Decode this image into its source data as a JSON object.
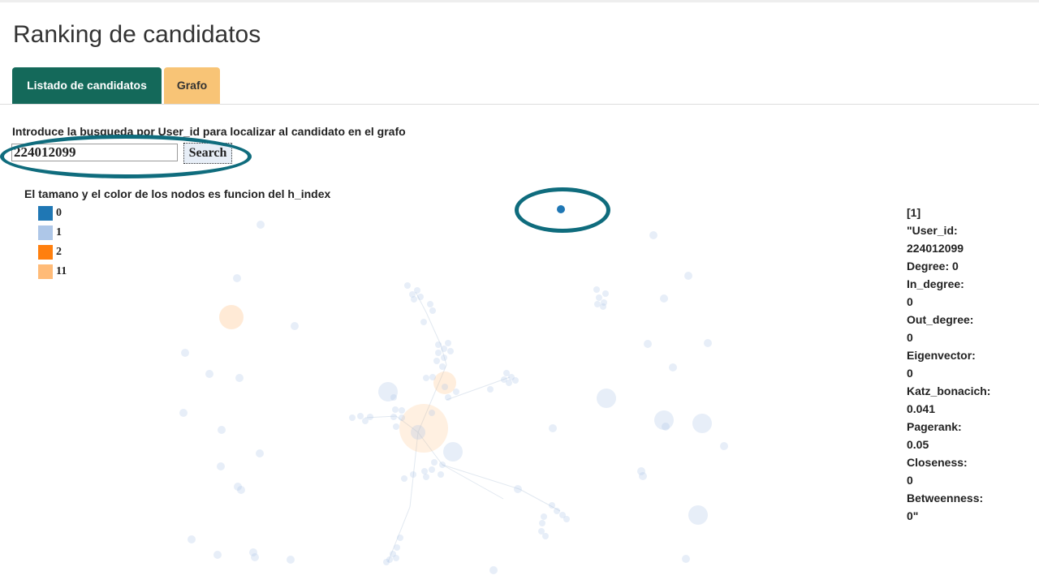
{
  "page": {
    "title": "Ranking de candidatos"
  },
  "tabs": [
    {
      "label": "Listado de candidatos"
    },
    {
      "label": "Grafo"
    }
  ],
  "search": {
    "label": "Introduce la busqueda por User_id para localizar al candidato en el grafo",
    "value": "224012099",
    "button_label": "Search"
  },
  "legend": {
    "title": "El tamano y el color de los nodos es funcion del h_index",
    "items": [
      {
        "label": "0",
        "color": "#1f77b4"
      },
      {
        "label": "1",
        "color": "#aec7e8"
      },
      {
        "label": "2",
        "color": "#ff7f0e"
      },
      {
        "label": "11",
        "color": "#ffbb78"
      }
    ]
  },
  "colors": {
    "accent_tab": "#14695a",
    "secondary_tab": "#f8c476",
    "annotation": "#0f6c7d",
    "node": "#aec7e8",
    "highlight_node": "#1f77b4"
  },
  "info": [
    "[1]",
    "\"User_id:",
    "224012099",
    "Degree: 0",
    "In_degree:",
    "0",
    "Out_degree:",
    "0",
    "Eigenvector:",
    "0",
    "Katz_bonacich:",
    "0.041",
    "Pagerank:",
    "0.05",
    "Closeness:",
    "0",
    "Betweenness:",
    "0\""
  ]
}
